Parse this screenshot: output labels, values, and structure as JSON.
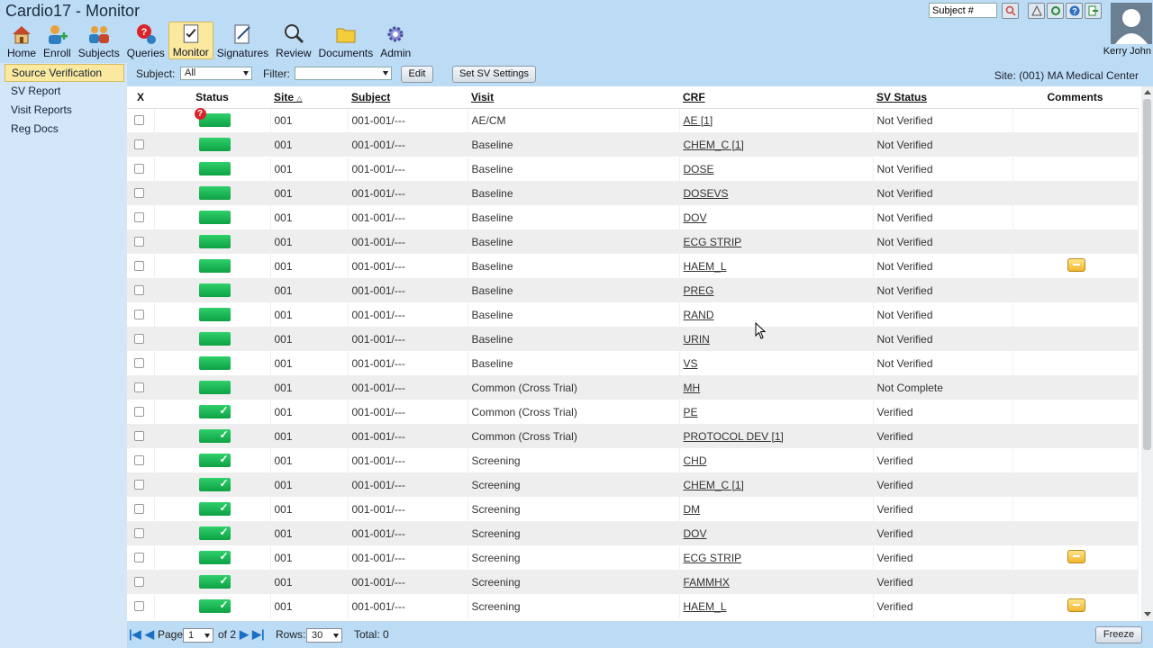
{
  "app": {
    "title": "Cardio17 - Monitor"
  },
  "nav": {
    "items": [
      {
        "label": "Home",
        "icon": "home-icon"
      },
      {
        "label": "Enroll",
        "icon": "enroll-icon"
      },
      {
        "label": "Subjects",
        "icon": "subjects-icon"
      },
      {
        "label": "Queries",
        "icon": "queries-icon"
      },
      {
        "label": "Monitor",
        "icon": "monitor-icon"
      },
      {
        "label": "Signatures",
        "icon": "signatures-icon"
      },
      {
        "label": "Review",
        "icon": "review-icon"
      },
      {
        "label": "Documents",
        "icon": "documents-icon"
      },
      {
        "label": "Admin",
        "icon": "admin-icon"
      }
    ]
  },
  "header": {
    "subject_search_value": "Subject #",
    "user_name": "Kerry John"
  },
  "sidebar": {
    "items": [
      {
        "label": "Source Verification"
      },
      {
        "label": "SV Report"
      },
      {
        "label": "Visit Reports"
      },
      {
        "label": "Reg Docs"
      }
    ]
  },
  "filters": {
    "subject_label": "Subject:",
    "subject_value": "All",
    "filter_label": "Filter:",
    "filter_value": "",
    "edit_label": "Edit",
    "set_sv_label": "Set SV Settings",
    "site_text": "Site: (001) MA Medical Center"
  },
  "table": {
    "headers": {
      "x": "X",
      "status": "Status",
      "site": "Site",
      "subject": "Subject",
      "visit": "Visit",
      "crf": "CRF",
      "sv_status": "SV Status",
      "comments": "Comments"
    },
    "rows": [
      {
        "site": "001",
        "subject": "001-001/---",
        "visit": "AE/CM",
        "crf": "AE [1]",
        "sv": "Not Verified",
        "verified": false,
        "query": true,
        "comment": false
      },
      {
        "site": "001",
        "subject": "001-001/---",
        "visit": "Baseline",
        "crf": "CHEM_C [1]",
        "sv": "Not Verified",
        "verified": false,
        "query": false,
        "comment": false
      },
      {
        "site": "001",
        "subject": "001-001/---",
        "visit": "Baseline",
        "crf": "DOSE",
        "sv": "Not Verified",
        "verified": false,
        "query": false,
        "comment": false
      },
      {
        "site": "001",
        "subject": "001-001/---",
        "visit": "Baseline",
        "crf": "DOSEVS",
        "sv": "Not Verified",
        "verified": false,
        "query": false,
        "comment": false
      },
      {
        "site": "001",
        "subject": "001-001/---",
        "visit": "Baseline",
        "crf": "DOV",
        "sv": "Not Verified",
        "verified": false,
        "query": false,
        "comment": false
      },
      {
        "site": "001",
        "subject": "001-001/---",
        "visit": "Baseline",
        "crf": "ECG STRIP",
        "sv": "Not Verified",
        "verified": false,
        "query": false,
        "comment": false
      },
      {
        "site": "001",
        "subject": "001-001/---",
        "visit": "Baseline",
        "crf": "HAEM_L",
        "sv": "Not Verified",
        "verified": false,
        "query": false,
        "comment": true
      },
      {
        "site": "001",
        "subject": "001-001/---",
        "visit": "Baseline",
        "crf": "PREG",
        "sv": "Not Verified",
        "verified": false,
        "query": false,
        "comment": false
      },
      {
        "site": "001",
        "subject": "001-001/---",
        "visit": "Baseline",
        "crf": "RAND",
        "sv": "Not Verified",
        "verified": false,
        "query": false,
        "comment": false
      },
      {
        "site": "001",
        "subject": "001-001/---",
        "visit": "Baseline",
        "crf": "URIN",
        "sv": "Not Verified",
        "verified": false,
        "query": false,
        "comment": false
      },
      {
        "site": "001",
        "subject": "001-001/---",
        "visit": "Baseline",
        "crf": "VS",
        "sv": "Not Verified",
        "verified": false,
        "query": false,
        "comment": false
      },
      {
        "site": "001",
        "subject": "001-001/---",
        "visit": "Common (Cross Trial)",
        "crf": "MH",
        "sv": "Not Complete",
        "verified": false,
        "query": false,
        "comment": false
      },
      {
        "site": "001",
        "subject": "001-001/---",
        "visit": "Common (Cross Trial)",
        "crf": "PE",
        "sv": "Verified",
        "verified": true,
        "query": false,
        "comment": false
      },
      {
        "site": "001",
        "subject": "001-001/---",
        "visit": "Common (Cross Trial)",
        "crf": "PROTOCOL DEV [1]",
        "sv": "Verified",
        "verified": true,
        "query": false,
        "comment": false
      },
      {
        "site": "001",
        "subject": "001-001/---",
        "visit": "Screening",
        "crf": "CHD",
        "sv": "Verified",
        "verified": true,
        "query": false,
        "comment": false
      },
      {
        "site": "001",
        "subject": "001-001/---",
        "visit": "Screening",
        "crf": "CHEM_C [1]",
        "sv": "Verified",
        "verified": true,
        "query": false,
        "comment": false
      },
      {
        "site": "001",
        "subject": "001-001/---",
        "visit": "Screening",
        "crf": "DM",
        "sv": "Verified",
        "verified": true,
        "query": false,
        "comment": false
      },
      {
        "site": "001",
        "subject": "001-001/---",
        "visit": "Screening",
        "crf": "DOV",
        "sv": "Verified",
        "verified": true,
        "query": false,
        "comment": false
      },
      {
        "site": "001",
        "subject": "001-001/---",
        "visit": "Screening",
        "crf": "ECG STRIP",
        "sv": "Verified",
        "verified": true,
        "query": false,
        "comment": true
      },
      {
        "site": "001",
        "subject": "001-001/---",
        "visit": "Screening",
        "crf": "FAMMHX",
        "sv": "Verified",
        "verified": true,
        "query": false,
        "comment": false
      },
      {
        "site": "001",
        "subject": "001-001/---",
        "visit": "Screening",
        "crf": "HAEM_L",
        "sv": "Verified",
        "verified": true,
        "query": false,
        "comment": true
      }
    ]
  },
  "pager": {
    "page_label": "Page",
    "page_value": "1",
    "of_label": "of 2",
    "rows_label": "Rows:",
    "rows_value": "30",
    "total_label": "Total: 0",
    "freeze_label": "Freeze"
  },
  "colors": {
    "background": "#bcdcf5",
    "active": "#fbe9a0",
    "status_green": "#15b34f",
    "query_red": "#d9242a"
  }
}
